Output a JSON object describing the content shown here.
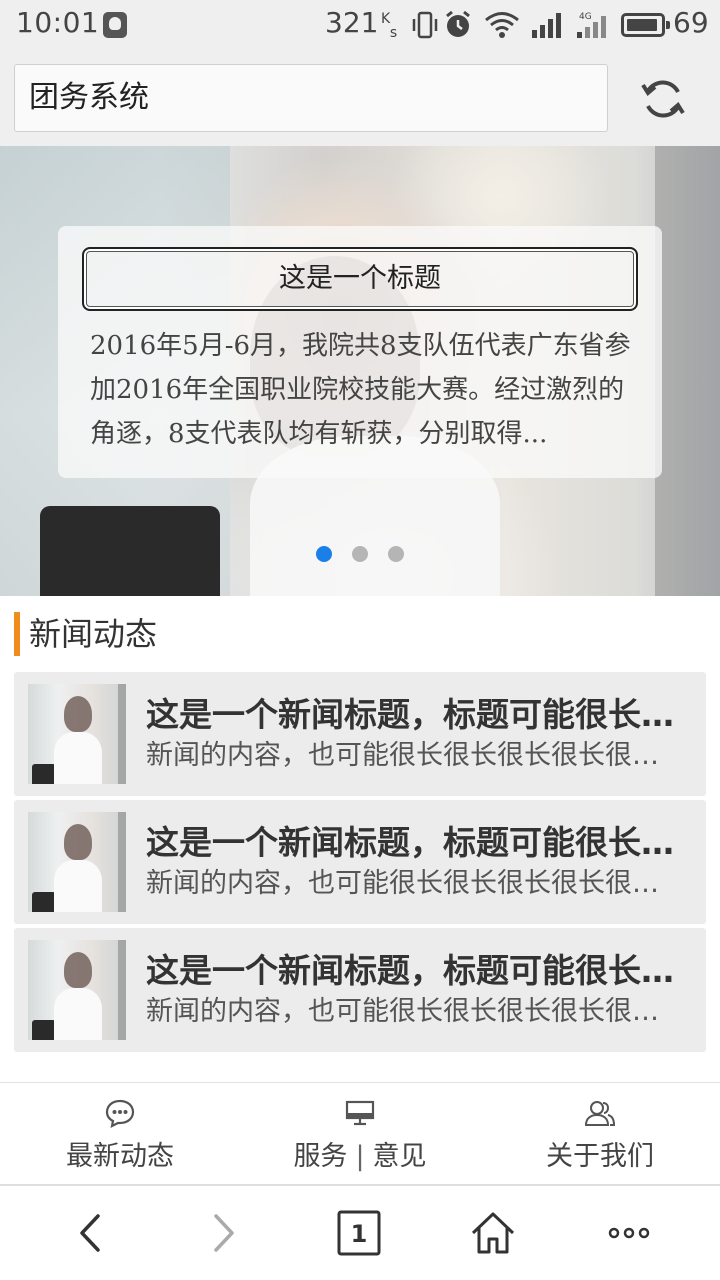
{
  "status_bar": {
    "time": "10:01",
    "net_speed": "321",
    "net_unit_top": "K",
    "net_unit_bottom": "s",
    "network_type": "4G",
    "battery_level": "69",
    "icons": [
      "qq-icon",
      "vibrate-icon",
      "alarm-icon",
      "wifi-icon",
      "signal-icon",
      "signal-4g-icon",
      "battery-icon"
    ]
  },
  "browser": {
    "url_title": "团务系统",
    "tab_count": "1"
  },
  "hero": {
    "title": "这是一个标题",
    "text": "2016年5月-6月，我院共8支队伍代表广东省参加2016年全国职业院校技能大赛。经过激烈的角逐，8支代表队均有斩获，分别取得...",
    "slide_count": 3,
    "active_slide": 1,
    "accent_color": "#1c7fe8"
  },
  "section": {
    "title": "新闻动态",
    "accent_color": "#f08c1c"
  },
  "news": [
    {
      "title": "这是一个新闻标题，标题可能很长很长很长",
      "desc": "新闻的内容，也可能很长很长很长很长很长很长"
    },
    {
      "title": "这是一个新闻标题，标题可能很长很长很长",
      "desc": "新闻的内容，也可能很长很长很长很长很长很长"
    },
    {
      "title": "这是一个新闻标题，标题可能很长很长很长",
      "desc": "新闻的内容，也可能很长很长很长很长很长很长"
    }
  ],
  "tabs": {
    "latest": {
      "label": "最新动态",
      "icon": "chat-bubble-icon"
    },
    "service": {
      "label_a": "服务",
      "separator": "|",
      "label_b": "意见",
      "icon": "monitor-icon"
    },
    "about": {
      "label": "关于我们",
      "icon": "users-icon"
    }
  }
}
